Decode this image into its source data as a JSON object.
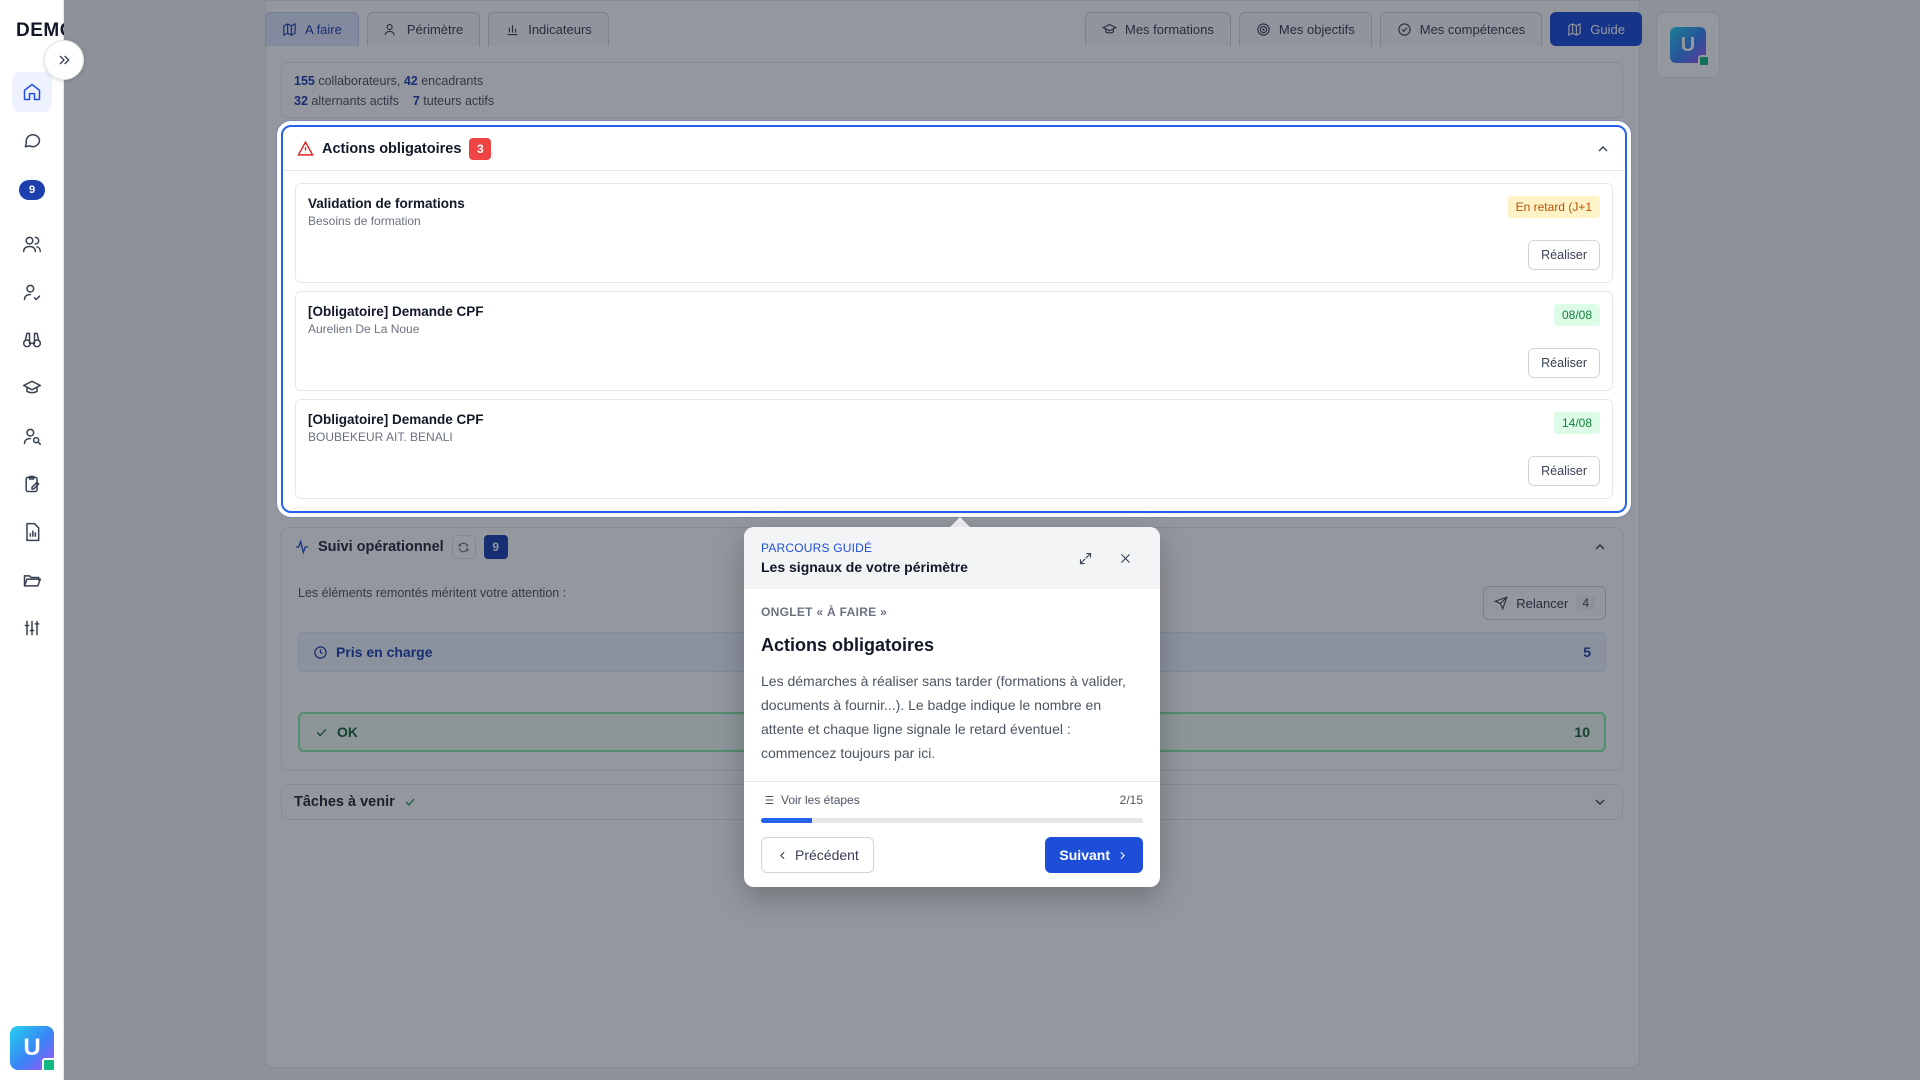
{
  "brand": "DEMO",
  "sidebar": {
    "messages_badge": "9"
  },
  "tabs_left": [
    {
      "label": "A faire"
    },
    {
      "label": "Périmètre"
    },
    {
      "label": "Indicateurs"
    }
  ],
  "tabs_right": [
    {
      "label": "Mes formations"
    },
    {
      "label": "Mes objectifs"
    },
    {
      "label": "Mes compétences"
    },
    {
      "label": "Guide"
    }
  ],
  "stats": {
    "collaborateurs_count": "155",
    "collaborateurs_label": "collaborateurs,",
    "encadrants_count": "42",
    "encadrants_label": "encadrants",
    "alternants_count": "32",
    "alternants_label": "alternants actifs",
    "tuteurs_count": "7",
    "tuteurs_label": "tuteurs actifs"
  },
  "actions": {
    "title": "Actions obligatoires",
    "count": "3",
    "items": [
      {
        "title": "Validation de formations",
        "subtitle": "Besoins de formation",
        "badge": "En retard (J+1",
        "button": "Réaliser"
      },
      {
        "title": "[Obligatoire] Demande CPF",
        "subtitle": "Aurelien De La Noue",
        "badge": "08/08",
        "button": "Réaliser"
      },
      {
        "title": "[Obligatoire] Demande CPF",
        "subtitle": "BOUBEKEUR AIT. BENALI",
        "badge": "14/08",
        "button": "Réaliser"
      }
    ]
  },
  "suivi": {
    "title": "Suivi opérationnel",
    "count": "9",
    "intro": "Les éléments remontés méritent votre attention :",
    "relancer_label": "Relancer",
    "relancer_count": "4",
    "prise_label": "Pris en charge",
    "prise_count": "5",
    "ok_label": "OK",
    "ok_count": "10"
  },
  "taches": {
    "title": "Tâches à venir"
  },
  "guide": {
    "kicker": "PARCOURS GUIDÉ",
    "title": "Les signaux de votre périmètre",
    "section": "ONGLET « À FAIRE »",
    "heading": "Actions obligatoires",
    "body": "Les démarches à réaliser sans tarder (formations à valider, documents à fournir...). Le badge indique le nombre en attente et chaque ligne signale le retard éventuel : commencez toujours par ici.",
    "steps_label": "Voir les étapes",
    "counter": "2/15",
    "progress": 0.133,
    "prev_label": "Précédent",
    "next_label": "Suivant"
  },
  "colors": {
    "accent": "#1d4ed8",
    "danger": "#ef4444",
    "success": "#16a34a",
    "warning": "#b45309"
  }
}
